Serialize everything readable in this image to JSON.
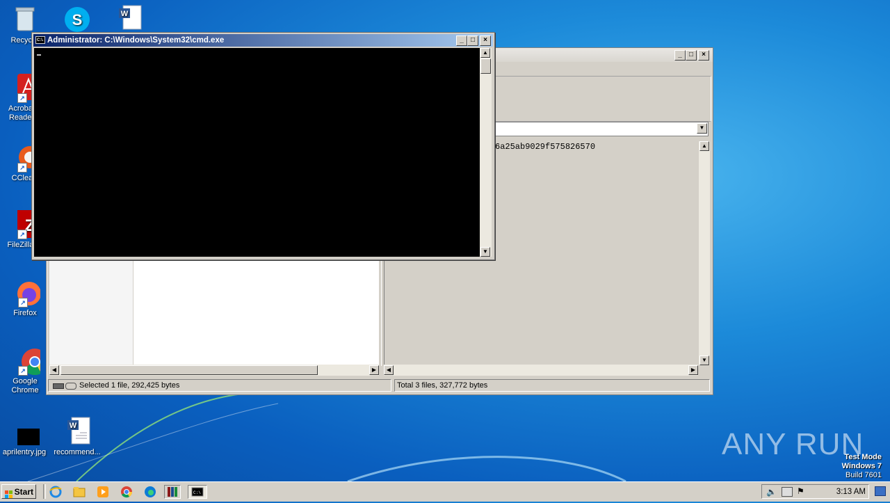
{
  "desktop": {
    "icons": [
      {
        "label": "Recycle"
      },
      {
        "label": "Acrobat Reader"
      },
      {
        "label": "CClean"
      },
      {
        "label": "FileZilla C"
      },
      {
        "label": "Firefox"
      },
      {
        "label": "Google Chrome"
      },
      {
        "label": "aprilentry.jpg"
      },
      {
        "label": "recommend..."
      }
    ]
  },
  "cmd_window": {
    "title": "Administrator: C:\\Windows\\System32\\cmd.exe",
    "icon_text": "C:\\."
  },
  "back_window": {
    "hash_text": "6a25ab9029f575826570",
    "status_left": "Selected 1 file, 292,425 bytes",
    "status_right": "Total 3 files, 327,772 bytes"
  },
  "taskbar": {
    "start_label": "Start",
    "clock": "3:13 AM",
    "pinned": [
      "internet-explorer-icon",
      "explorer-folder-icon",
      "media-player-icon",
      "chrome-icon",
      "edge-icon",
      "winrar-icon",
      "cmd-icon"
    ]
  },
  "watermark": {
    "line1": "Test Mode",
    "line2": "Windows 7",
    "line3": "Build 7601",
    "brand": "ANY RUN"
  }
}
